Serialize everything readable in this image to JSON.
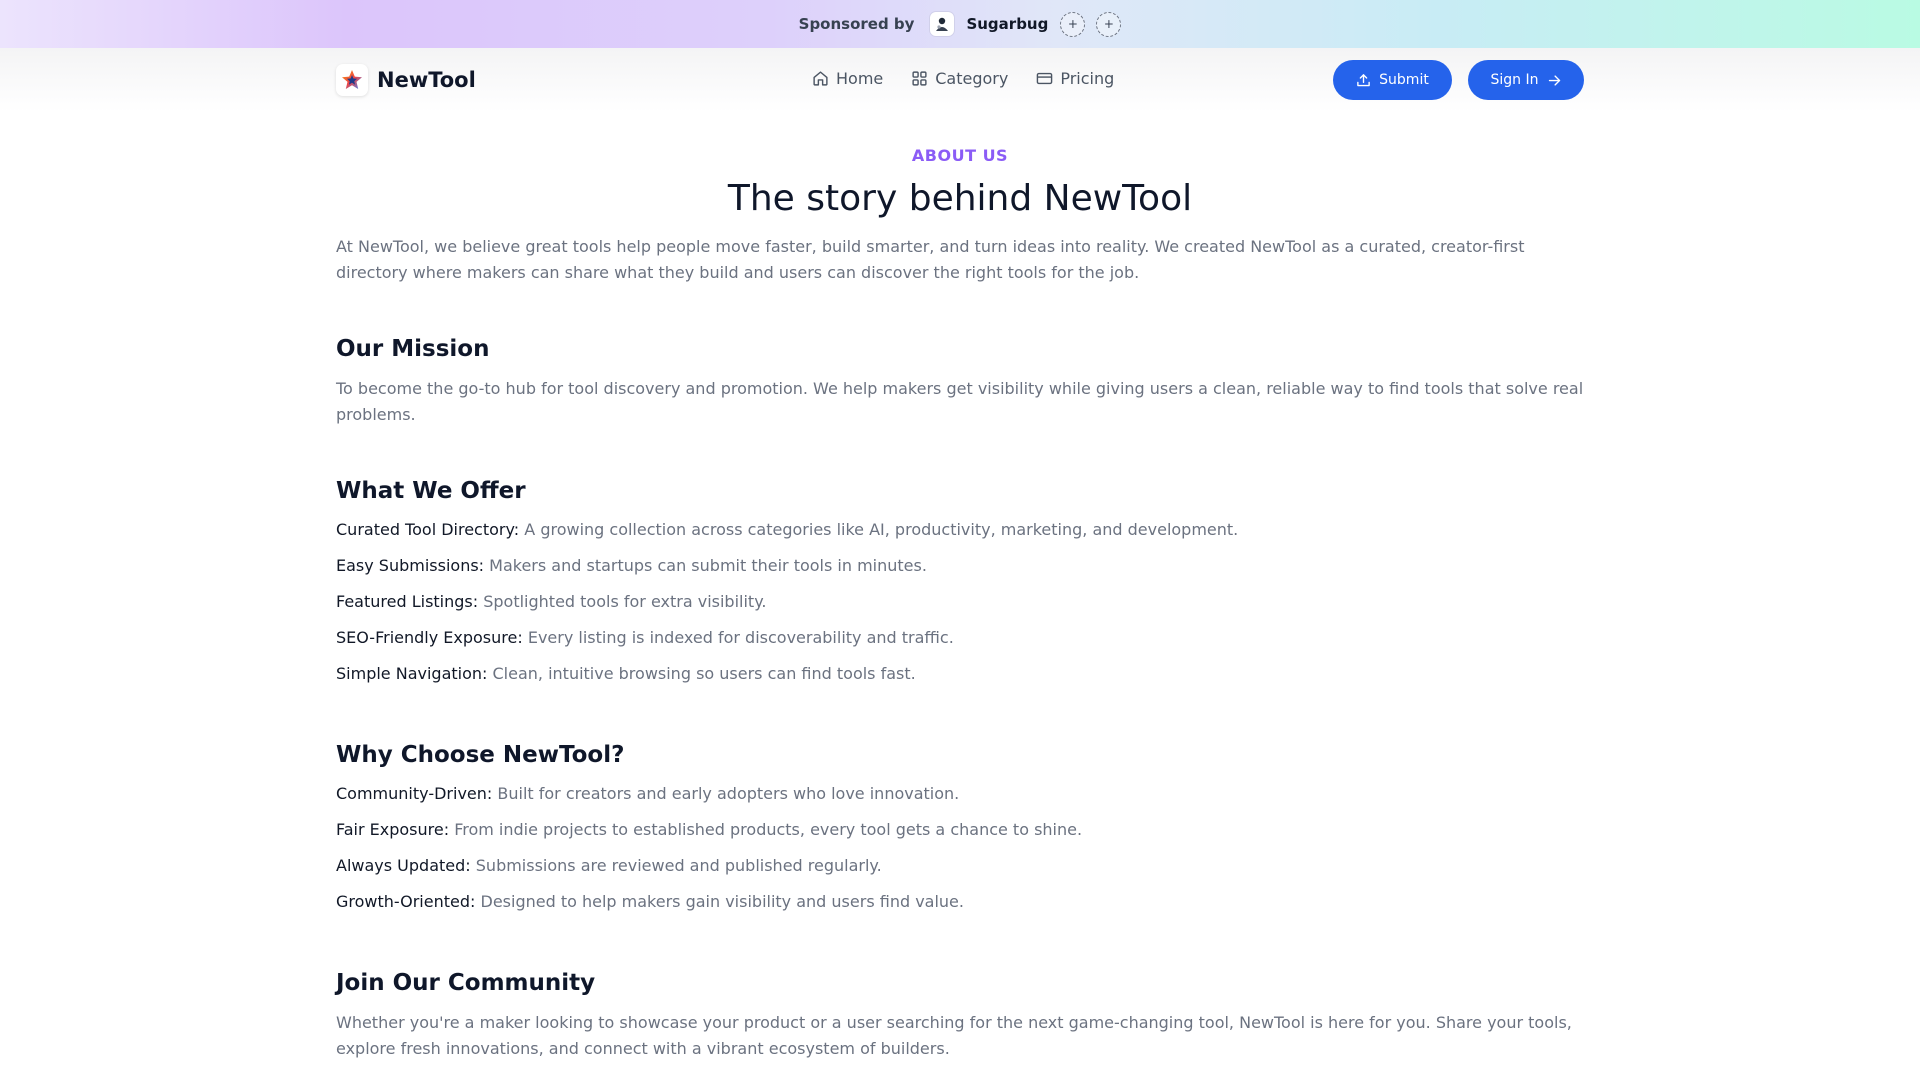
{
  "sponsor": {
    "label": "Sponsored by",
    "name": "Sugarbug",
    "slots": [
      "+",
      "+"
    ]
  },
  "header": {
    "brand": "NewTool",
    "nav": [
      {
        "label": "Home",
        "icon": "home-icon"
      },
      {
        "label": "Category",
        "icon": "grid-icon"
      },
      {
        "label": "Pricing",
        "icon": "card-icon"
      }
    ],
    "submit_label": "Submit",
    "signin_label": "Sign In"
  },
  "about": {
    "eyebrow": "ABOUT US",
    "title": "The story behind NewTool",
    "intro": "At NewTool, we believe great tools help people move faster, build smarter, and turn ideas into reality. We created NewTool as a curated, creator-first directory where makers can share what they build and users can discover the right tools for the job.",
    "mission_heading": "Our Mission",
    "mission_text": "To become the go-to hub for tool discovery and promotion. We help makers get visibility while giving users a clean, reliable way to find tools that solve real problems.",
    "offer_heading": "What We Offer",
    "offer_items": [
      {
        "k": "Curated Tool Directory:",
        "v": "A growing collection across categories like AI, productivity, marketing, and development."
      },
      {
        "k": "Easy Submissions:",
        "v": "Makers and startups can submit their tools in minutes."
      },
      {
        "k": "Featured Listings:",
        "v": "Spotlighted tools for extra visibility."
      },
      {
        "k": "SEO-Friendly Exposure:",
        "v": "Every listing is indexed for discoverability and traffic."
      },
      {
        "k": "Simple Navigation:",
        "v": "Clean, intuitive browsing so users can find tools fast."
      }
    ],
    "why_heading": "Why Choose NewTool?",
    "why_items": [
      {
        "k": "Community-Driven:",
        "v": "Built for creators and early adopters who love innovation."
      },
      {
        "k": "Fair Exposure:",
        "v": "From indie projects to established products, every tool gets a chance to shine."
      },
      {
        "k": "Always Updated:",
        "v": "Submissions are reviewed and published regularly."
      },
      {
        "k": "Growth-Oriented:",
        "v": "Designed to help makers gain visibility and users find value."
      }
    ],
    "join_heading": "Join Our Community",
    "join_text": "Whether you're a maker looking to showcase your product or a user searching for the next game-changing tool, NewTool is here for you. Share your tools, explore fresh innovations, and connect with a vibrant ecosystem of builders."
  },
  "colors": {
    "accent": "#2563eb",
    "eyebrow": "#8b5cf6",
    "muted_text": "#6b7280"
  }
}
